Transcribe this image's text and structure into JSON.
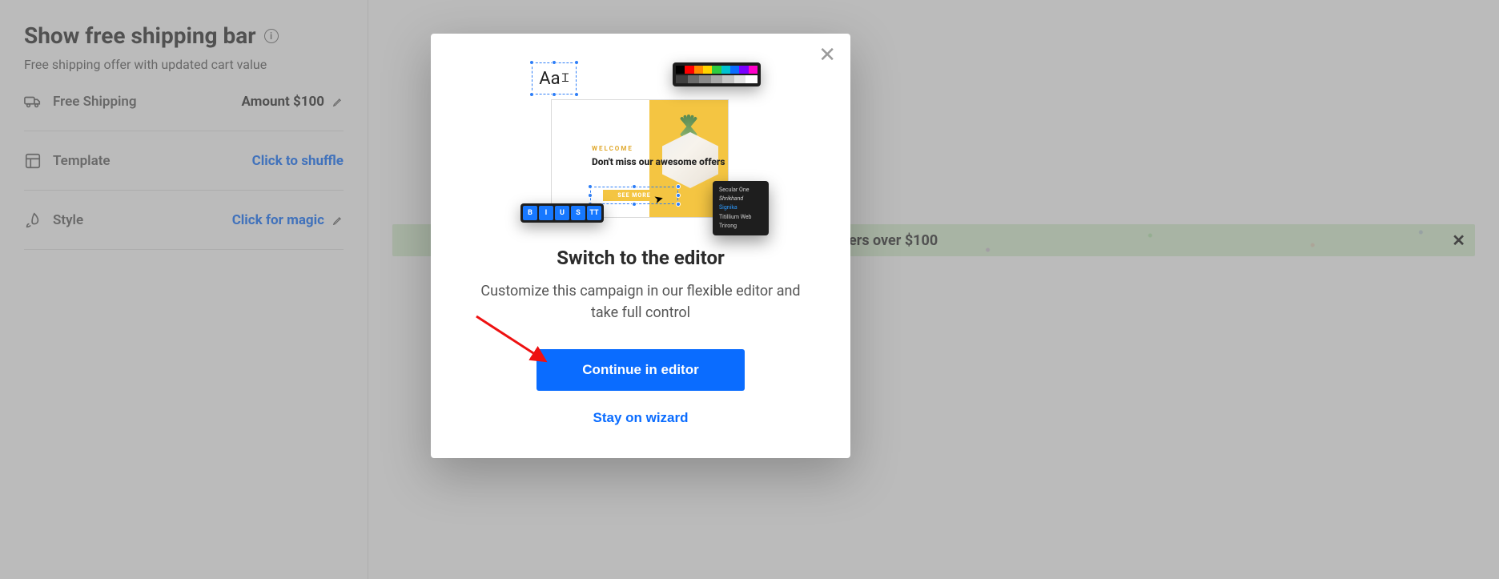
{
  "sidebar": {
    "title": "Show free shipping bar",
    "subtitle": "Free shipping offer with updated cart value",
    "rows": {
      "shipping": {
        "label": "Free Shipping",
        "value": "Amount $100"
      },
      "template": {
        "label": "Template",
        "link": "Click to shuffle"
      },
      "style": {
        "label": "Style",
        "link": "Click for magic"
      }
    }
  },
  "banner": {
    "text_visible": "ers over $100"
  },
  "modal": {
    "title": "Switch to the editor",
    "description": "Customize this campaign in our flexible editor and take full control",
    "primary": "Continue in editor",
    "secondary": "Stay on wizard",
    "illustration": {
      "aa": "Aa",
      "welcome": "WELCOME",
      "headline": "Don't miss our awesome offers",
      "cta": "SEE MORE",
      "format_buttons": [
        "B",
        "I",
        "U",
        "S",
        "TT"
      ],
      "fonts": [
        "Secular One",
        "Shrikhand",
        "Signika",
        "Titillium Web",
        "Trirong"
      ],
      "palette": [
        "#000000",
        "#ff0000",
        "#ff8a00",
        "#ffd400",
        "#2ecc40",
        "#00c2d1",
        "#0a6cff",
        "#7a00ff",
        "#ff00c8"
      ],
      "greys": [
        "#404040",
        "#6b6b6b",
        "#8a8a8a",
        "#a8a8a8",
        "#c6c6c6",
        "#e4e4e4",
        "#ffffff"
      ]
    }
  }
}
